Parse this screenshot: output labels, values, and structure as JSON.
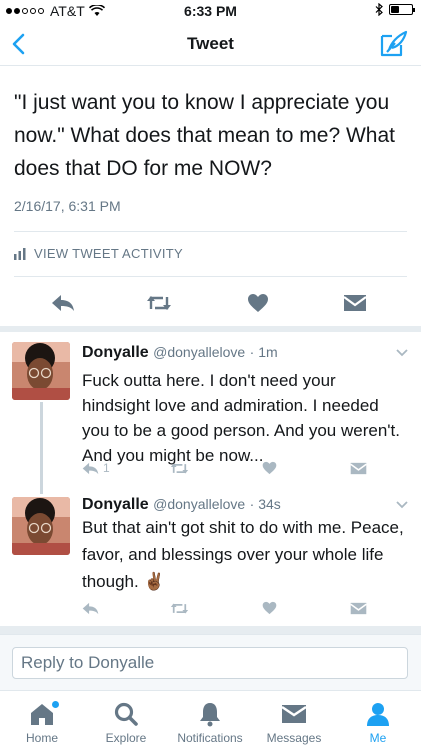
{
  "status_bar": {
    "carrier": "AT&T",
    "time": "6:33 PM",
    "signal_bars": 2,
    "battery_level": 0.4
  },
  "nav": {
    "title": "Tweet",
    "back_icon": "chevron-left-icon",
    "compose_icon": "compose-icon"
  },
  "tweet": {
    "text": "\"I just want you to know I appreciate you now.\" What does that mean to me? What does that DO for me NOW?",
    "date": "2/16/17, 6:31 PM",
    "activity_label": "VIEW TWEET ACTIVITY"
  },
  "replies": [
    {
      "name": "Donyalle",
      "handle": "@donyallelove",
      "time": "· 1m",
      "text": "Fuck outta here. I don't need your hindsight love and admiration. I needed you to be a good person. And you weren't. And you might be now...",
      "reply_count": "1"
    },
    {
      "name": "Donyalle",
      "handle": "@donyallelove",
      "time": "· 34s",
      "text": "But that ain't got shit to do with me. Peace, favor, and blessings over your whole life though. ✌🏾",
      "reply_count": ""
    }
  ],
  "reply_box": {
    "placeholder": "Reply to Donyalle"
  },
  "tabs": [
    {
      "label": "Home",
      "icon": "home-icon"
    },
    {
      "label": "Explore",
      "icon": "search-icon"
    },
    {
      "label": "Notifications",
      "icon": "bell-icon"
    },
    {
      "label": "Messages",
      "icon": "envelope-icon"
    },
    {
      "label": "Me",
      "icon": "person-icon"
    }
  ],
  "colors": {
    "accent": "#1da1f2",
    "muted": "#657786",
    "icon_muted": "#aab8c2"
  }
}
